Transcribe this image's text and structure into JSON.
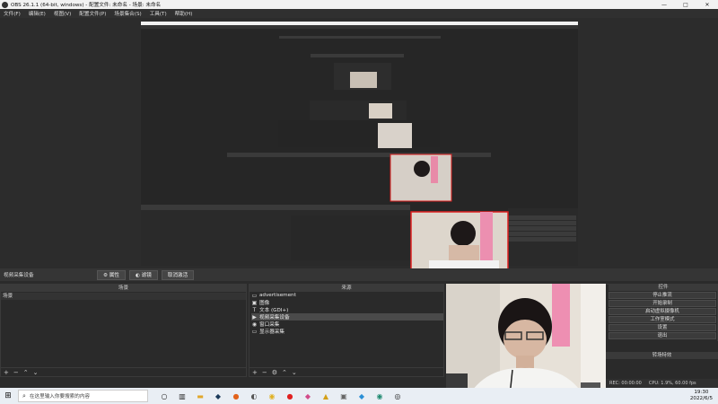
{
  "window": {
    "title": "OBS 26.1.1 (64-bit, windows) - 配置文件: 未命名 - 场景: 未命名",
    "controls": [
      "—",
      "□",
      "✕"
    ]
  },
  "menu": [
    "文件(F)",
    "编辑(E)",
    "视图(V)",
    "配置文件(P)",
    "场景集合(S)",
    "工具(T)",
    "帮助(H)"
  ],
  "toolbar": {
    "source_name": "视频采集设备",
    "properties": "⚙ 属性",
    "filters": "◐ 滤镜",
    "deactivate": "取消激活"
  },
  "scenes": {
    "header": "场景",
    "items": [
      "场景"
    ]
  },
  "sources": {
    "header": "来源",
    "items": [
      {
        "icon": "display-icon",
        "glyph": "▭",
        "label": "advertisement"
      },
      {
        "icon": "image-icon",
        "glyph": "▣",
        "label": "图像"
      },
      {
        "icon": "text-icon",
        "glyph": "T",
        "label": "文本 (GDI+)"
      },
      {
        "icon": "camera-icon",
        "glyph": "▶",
        "label": "视频采集设备",
        "selected": true
      },
      {
        "icon": "eye-icon",
        "glyph": "◉",
        "label": "窗口采集"
      },
      {
        "icon": "monitor-icon",
        "glyph": "▭",
        "label": "显示器采集"
      }
    ]
  },
  "controls": {
    "header": "控件",
    "buttons": [
      "停止推流",
      "开始录制",
      "启动虚拟摄像机",
      "工作室模式",
      "设置",
      "退出"
    ]
  },
  "mixer": {
    "title": "转场特效"
  },
  "status": {
    "rec": "REC: 00:00:00",
    "cpu": "CPU: 1.9%, 60.00 fps"
  },
  "taskbar": {
    "search_placeholder": "在这里输入你要搜索的内容",
    "time": "19:30",
    "date": "2022/6/5"
  },
  "colors": {
    "window_bg": "#2b2b2b",
    "panel_bg": "#2a2a2a",
    "accent_red": "#e02020",
    "taskbar_bg": "#e9eef4"
  }
}
